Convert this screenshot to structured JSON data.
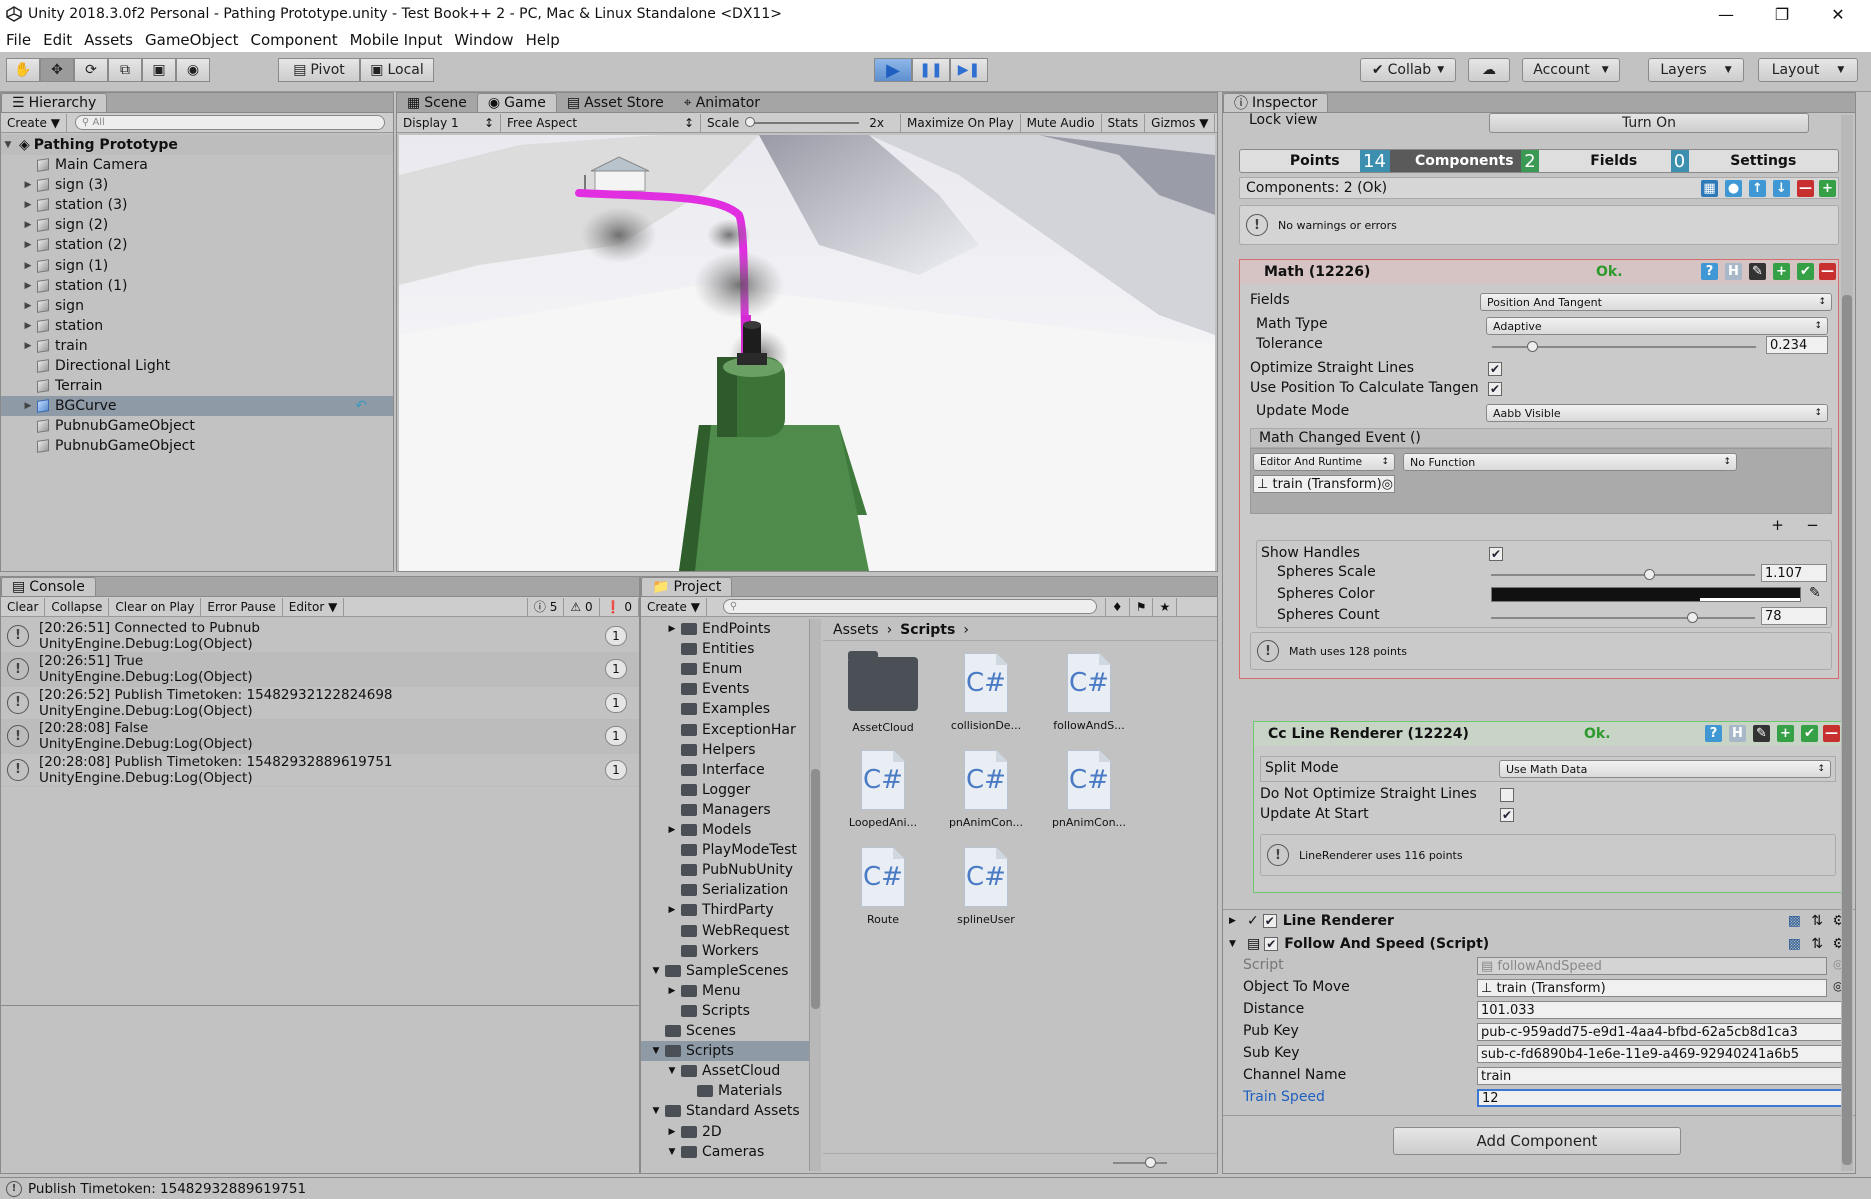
{
  "window": {
    "title": "Unity 2018.3.0f2 Personal - Pathing Prototype.unity - Test Book++ 2 - PC, Mac & Linux Standalone <DX11>"
  },
  "menu": [
    "File",
    "Edit",
    "Assets",
    "GameObject",
    "Component",
    "Mobile Input",
    "Window",
    "Help"
  ],
  "toolbar": {
    "pivot": "Pivot",
    "local": "Local",
    "collab": "Collab",
    "account": "Account",
    "layers": "Layers",
    "layout": "Layout",
    "play_color": "#3c7fd1"
  },
  "hierarchy": {
    "tab": "Hierarchy",
    "create": "Create",
    "search_placeholder": "All",
    "scene": "Pathing Prototype",
    "items": [
      {
        "label": "Main Camera",
        "expandable": false
      },
      {
        "label": "sign (3)",
        "expandable": true
      },
      {
        "label": "station (3)",
        "expandable": true
      },
      {
        "label": "sign (2)",
        "expandable": true
      },
      {
        "label": "station (2)",
        "expandable": true
      },
      {
        "label": "sign (1)",
        "expandable": true
      },
      {
        "label": "station (1)",
        "expandable": true
      },
      {
        "label": "sign",
        "expandable": true
      },
      {
        "label": "station",
        "expandable": true
      },
      {
        "label": "train",
        "expandable": true
      },
      {
        "label": "Directional Light",
        "expandable": false
      },
      {
        "label": "Terrain",
        "expandable": false
      },
      {
        "label": "BGCurve",
        "expandable": true,
        "selected": true
      },
      {
        "label": "PubnubGameObject",
        "expandable": false
      },
      {
        "label": "PubnubGameObject",
        "expandable": false
      }
    ]
  },
  "game": {
    "tabs": [
      "Scene",
      "Game",
      "Asset Store",
      "Animator"
    ],
    "display": "Display 1",
    "aspect": "Free Aspect",
    "scale_label": "Scale",
    "scale_value": "2x",
    "maximize": "Maximize On Play",
    "mute": "Mute Audio",
    "stats": "Stats",
    "gizmos": "Gizmos",
    "path_color": "#e02ee0"
  },
  "console": {
    "tab": "Console",
    "buttons": [
      "Clear",
      "Collapse",
      "Clear on Play",
      "Error Pause",
      "Editor"
    ],
    "counts": {
      "log": "5",
      "warn": "0",
      "error": "0"
    },
    "entries": [
      {
        "line1": "[20:26:51] Connected to Pubnub",
        "line2": "UnityEngine.Debug:Log(Object)",
        "count": "1"
      },
      {
        "line1": "[20:26:51] True",
        "line2": "UnityEngine.Debug:Log(Object)",
        "count": "1"
      },
      {
        "line1": "[20:26:52] Publish Timetoken: 15482932122824698",
        "line2": "UnityEngine.Debug:Log(Object)",
        "count": "1"
      },
      {
        "line1": "[20:28:08] False",
        "line2": "UnityEngine.Debug:Log(Object)",
        "count": "1"
      },
      {
        "line1": "[20:28:08] Publish Timetoken: 15482932889619751",
        "line2": "UnityEngine.Debug:Log(Object)",
        "count": "1"
      }
    ]
  },
  "project": {
    "tab": "Project",
    "create": "Create",
    "tree": [
      {
        "label": "EndPoints",
        "indent": 2,
        "arrow": "right"
      },
      {
        "label": "Entities",
        "indent": 2,
        "arrow": ""
      },
      {
        "label": "Enum",
        "indent": 2,
        "arrow": ""
      },
      {
        "label": "Events",
        "indent": 2,
        "arrow": ""
      },
      {
        "label": "Examples",
        "indent": 2,
        "arrow": ""
      },
      {
        "label": "ExceptionHar",
        "indent": 2,
        "arrow": ""
      },
      {
        "label": "Helpers",
        "indent": 2,
        "arrow": ""
      },
      {
        "label": "Interface",
        "indent": 2,
        "arrow": ""
      },
      {
        "label": "Logger",
        "indent": 2,
        "arrow": ""
      },
      {
        "label": "Managers",
        "indent": 2,
        "arrow": ""
      },
      {
        "label": "Models",
        "indent": 2,
        "arrow": "right"
      },
      {
        "label": "PlayModeTest",
        "indent": 2,
        "arrow": ""
      },
      {
        "label": "PubNubUnity",
        "indent": 2,
        "arrow": ""
      },
      {
        "label": "Serialization",
        "indent": 2,
        "arrow": ""
      },
      {
        "label": "ThirdParty",
        "indent": 2,
        "arrow": "right"
      },
      {
        "label": "WebRequest",
        "indent": 2,
        "arrow": ""
      },
      {
        "label": "Workers",
        "indent": 2,
        "arrow": ""
      },
      {
        "label": "SampleScenes",
        "indent": 1,
        "arrow": "down"
      },
      {
        "label": "Menu",
        "indent": 2,
        "arrow": "right"
      },
      {
        "label": "Scripts",
        "indent": 2,
        "arrow": ""
      },
      {
        "label": "Scenes",
        "indent": 1,
        "arrow": ""
      },
      {
        "label": "Scripts",
        "indent": 1,
        "arrow": "down",
        "selected": true
      },
      {
        "label": "AssetCloud",
        "indent": 2,
        "arrow": "down"
      },
      {
        "label": "Materials",
        "indent": 3,
        "arrow": ""
      },
      {
        "label": "Standard Assets",
        "indent": 1,
        "arrow": "down"
      },
      {
        "label": "2D",
        "indent": 2,
        "arrow": "right"
      },
      {
        "label": "Cameras",
        "indent": 2,
        "arrow": "down"
      }
    ],
    "breadcrumb": {
      "root": "Assets",
      "current": "Scripts"
    },
    "assets": [
      {
        "label": "AssetCloud",
        "kind": "folder"
      },
      {
        "label": "collisionDe...",
        "kind": "cs"
      },
      {
        "label": "followAndS...",
        "kind": "cs"
      },
      {
        "label": "LoopedAni...",
        "kind": "cs"
      },
      {
        "label": "pnAnimCon...",
        "kind": "cs"
      },
      {
        "label": "pnAnimCon...",
        "kind": "cs"
      },
      {
        "label": "Route",
        "kind": "cs"
      },
      {
        "label": "splineUser",
        "kind": "cs"
      }
    ],
    "cs_glyph": "C#"
  },
  "inspector": {
    "tab": "Inspector",
    "lock_view": "Lock view",
    "turn_on": "Turn On",
    "subtabs": [
      {
        "label": "Points",
        "badge": "14"
      },
      {
        "label": "Components",
        "badge": "2"
      },
      {
        "label": "Fields",
        "badge": "0"
      },
      {
        "label": "Settings",
        "badge": ""
      }
    ],
    "components_status": "Components: 2 (Ok)",
    "no_warnings": "No warnings or errors",
    "math": {
      "title": "Math (12226)",
      "ok": "Ok.",
      "fields_label": "Fields",
      "fields_value": "Position And Tangent",
      "math_type_label": "Math Type",
      "math_type_value": "Adaptive",
      "tolerance_label": "Tolerance",
      "tolerance_value": "0.234",
      "tolerance_fraction": 0.15,
      "optimize_label": "Optimize Straight Lines",
      "use_pos_label": "Use Position To Calculate Tangen",
      "update_mode_label": "Update Mode",
      "update_mode_value": "Aabb Visible",
      "event_label": "Math Changed Event ()",
      "event_runtime": "Editor And Runtime",
      "event_function": "No Function",
      "event_target": "train (Transform)",
      "show_handles": "Show Handles",
      "spheres_scale_label": "Spheres Scale",
      "spheres_scale_value": "1.107",
      "spheres_scale_fraction": 0.6,
      "spheres_color_label": "Spheres Color",
      "spheres_count_label": "Spheres Count",
      "spheres_count_value": "78",
      "spheres_count_fraction": 0.76,
      "uses_points": "Math uses 128 points"
    },
    "line_renderer_cc": {
      "title": "Cc Line Renderer (12224)",
      "ok": "Ok.",
      "split_mode_label": "Split Mode",
      "split_mode_value": "Use Math Data",
      "do_not_optimize": "Do Not Optimize Straight Lines",
      "update_at_start": "Update At Start",
      "uses_points": "LineRenderer uses 116 points"
    },
    "line_renderer": "Line Renderer",
    "follow": {
      "title": "Follow And Speed (Script)",
      "script_label": "Script",
      "script_value": "followAndSpeed",
      "object_label": "Object To Move",
      "object_value": "train (Transform)",
      "distance_label": "Distance",
      "distance_value": "101.033",
      "pub_label": "Pub Key",
      "pub_value": "pub-c-959add75-e9d1-4aa4-bfbd-62a5cb8d1ca3",
      "sub_label": "Sub Key",
      "sub_value": "sub-c-fd6890b4-1e6e-11e9-a469-92940241a6b5",
      "channel_label": "Channel Name",
      "channel_value": "train",
      "speed_label": "Train Speed",
      "speed_value": "12"
    },
    "add_component": "Add Component"
  },
  "status": "Publish Timetoken: 15482932889619751"
}
